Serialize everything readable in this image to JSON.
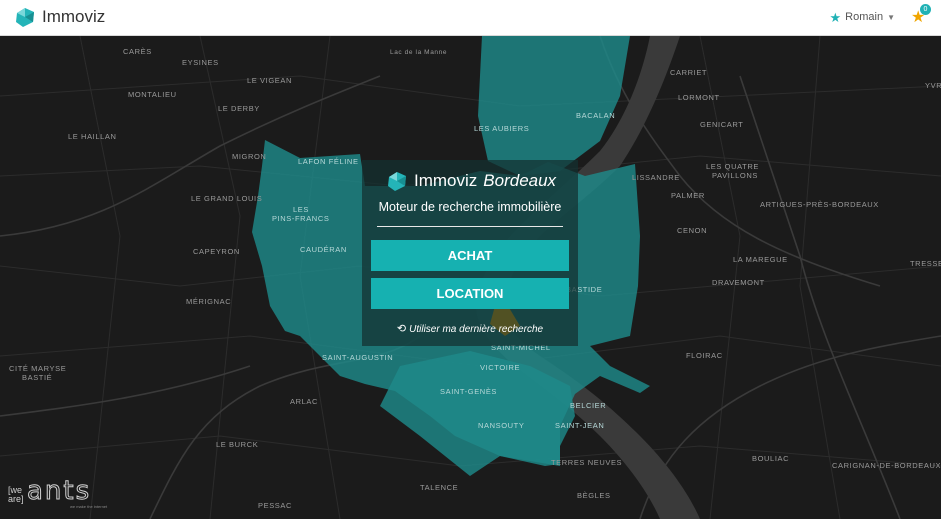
{
  "header": {
    "brand": "Immoviz",
    "user": "Romain",
    "favorites_count": "0"
  },
  "icons": {
    "brand_logo": "teal-gem-icon",
    "user_star": "star-icon",
    "user_caret": "caret-down-icon",
    "favorites": "star-icon",
    "history": "history-icon"
  },
  "colors": {
    "teal": "#16b1b1",
    "zone": "#1e8a8a",
    "orange": "#f0a500",
    "map_bg": "#1b1b1b"
  },
  "search_panel": {
    "title_prefix": "Immoviz",
    "title_city": "Bordeaux",
    "subtitle": "Moteur de recherche immobilière",
    "buy_button": "ACHAT",
    "rent_button": "LOCATION",
    "last_search_link": "Utiliser ma dernière recherche"
  },
  "map": {
    "places": [
      "CARÈS",
      "EYSINES",
      "LE VIGEAN",
      "MONTALIEU",
      "LE DERBY",
      "LE HAILLAN",
      "MIGRON",
      "LAFON FÉLINE",
      "LE GRAND LOUIS",
      "LES",
      "PINS-FRANCS",
      "CAUDÉRAN",
      "CAPEYRON",
      "MÉRIGNAC",
      "SAINT-AUGUSTIN",
      "CITÉ MARYSE",
      "BASTIÉ",
      "ARLAC",
      "LE BURCK",
      "PESSAC",
      "TALENCE",
      "TERRES NEUVES",
      "BÈGLES",
      "SAINT-MICHEL",
      "VICTOIRE",
      "SAINT-GENÈS",
      "NANSOUTY",
      "SAINT-JEAN",
      "BELCIER",
      "FLOIRAC",
      "BOULIAC",
      "CARIGNAN-DE-BORDEAUX",
      "LES AUBIERS",
      "BACALAN",
      "CARRIET",
      "LORMONT",
      "GENICART",
      "LES QUATRE",
      "PAVILLONS",
      "LISSANDRE",
      "PALMER",
      "ARTIGUES-PRÈS-BORDEAUX",
      "CENON",
      "LA MAREGUE",
      "DRAVEMONT",
      "TRESSE",
      "YVR",
      "BASTIDE",
      "Lac de la Manne"
    ]
  },
  "footer_logo": {
    "we_are": "[we are]",
    "ants": "ants",
    "tagline": "we make the internet"
  }
}
